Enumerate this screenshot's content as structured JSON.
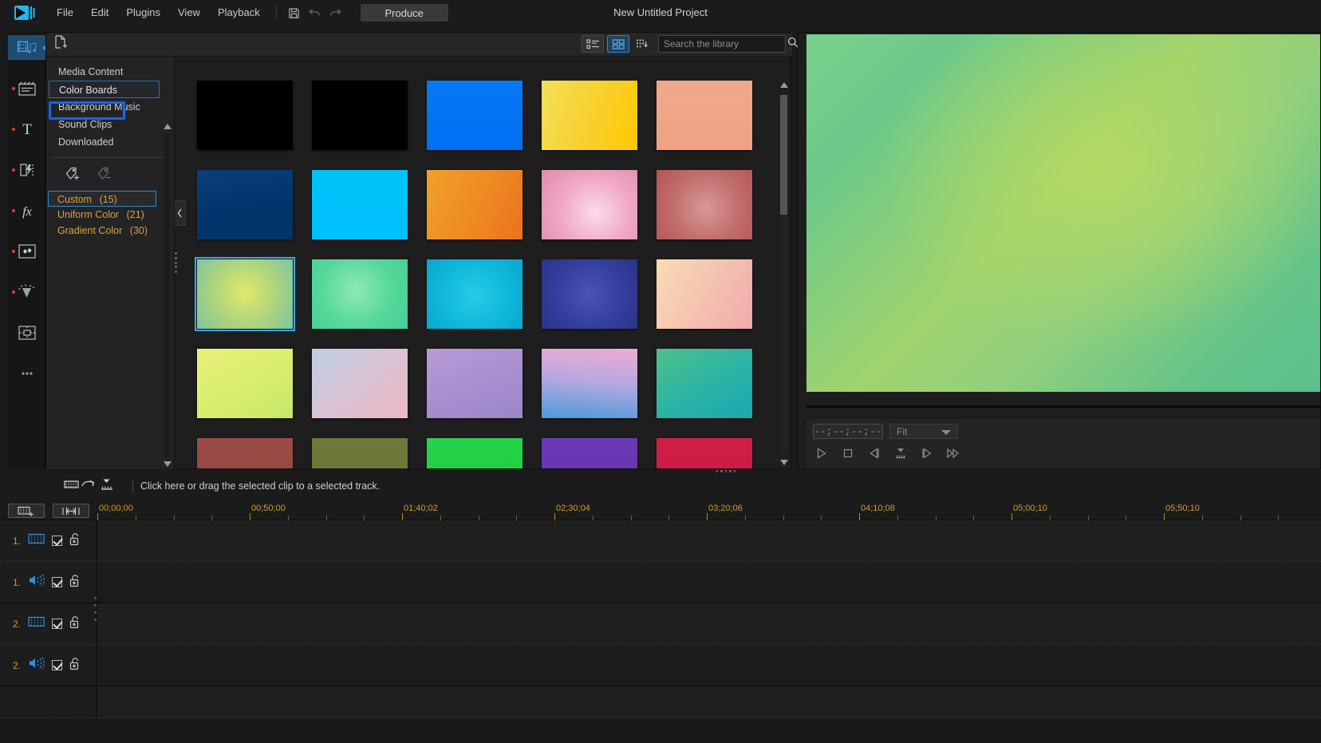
{
  "menu": {
    "logo_icon": "app-logo-icon",
    "items": [
      "File",
      "Edit",
      "Plugins",
      "View",
      "Playback"
    ],
    "save_icon": "save-icon",
    "undo_icon": "undo-icon",
    "redo_icon": "redo-icon",
    "produce_label": "Produce",
    "project_title": "New Untitled Project"
  },
  "rail": {
    "items": [
      {
        "name": "media-library",
        "icon": "media-music-icon",
        "active": true,
        "badge": false
      },
      {
        "name": "titles",
        "icon": "clapperboard-icon",
        "active": false,
        "badge": true
      },
      {
        "name": "text",
        "icon": "text-t-icon",
        "active": false,
        "badge": true
      },
      {
        "name": "transitions",
        "icon": "transition-icon",
        "active": false,
        "badge": true
      },
      {
        "name": "effects",
        "icon": "fx-icon",
        "active": false,
        "badge": true
      },
      {
        "name": "overlays",
        "icon": "overlay-star-icon",
        "active": false,
        "badge": true
      },
      {
        "name": "particles",
        "icon": "particle-icon",
        "active": false,
        "badge": true
      },
      {
        "name": "split-screen",
        "icon": "split-screen-icon",
        "active": false,
        "badge": false
      },
      {
        "name": "more",
        "icon": "more-dots-icon",
        "active": false,
        "badge": false
      }
    ]
  },
  "library": {
    "new_file_icon": "new-file-icon",
    "view_list_icon": "list-view-icon",
    "view_grid_icon": "grid-view-icon",
    "sort_icon": "sort-descending-icon",
    "selected_view": "grid",
    "search": {
      "placeholder": "Search the library",
      "value": "",
      "icon": "search-icon"
    },
    "categories": [
      {
        "label": "Media Content",
        "state": "normal"
      },
      {
        "label": "Color Boards",
        "state": "highlighted"
      },
      {
        "label": "Background Music",
        "state": "normal"
      },
      {
        "label": "Sound Clips",
        "state": "normal"
      },
      {
        "label": "Downloaded",
        "state": "normal"
      }
    ],
    "tag_tools": [
      {
        "name": "add-tag-icon",
        "label": ""
      },
      {
        "name": "remove-tag-icon",
        "label": ""
      }
    ],
    "tags": [
      {
        "label": "Custom",
        "count": "(15)",
        "selected": true
      },
      {
        "label": "Uniform Color",
        "count": "(21)",
        "selected": false
      },
      {
        "label": "Gradient Color",
        "count": "(30)",
        "selected": false
      }
    ],
    "collapse_icon": "chevron-left-icon",
    "scroll_up_icon": "triangle-up-icon",
    "scroll_down_icon": "triangle-down-icon",
    "swatches": [
      {
        "id": "sw-1",
        "css": "linear-gradient(180deg,#000 0%,#000 100%)",
        "selected": false
      },
      {
        "id": "sw-2",
        "css": "linear-gradient(180deg,#010101 0%,#000 100%)",
        "selected": false
      },
      {
        "id": "sw-3",
        "css": "linear-gradient(180deg,#0579f5 0%,#0070f2 100%)",
        "selected": false
      },
      {
        "id": "sw-4",
        "css": "linear-gradient(110deg,#f2e05a 0%,#f9cf2c 55%,#ffc800 100%)",
        "selected": false
      },
      {
        "id": "sw-5",
        "css": "linear-gradient(180deg,#f0a98c 0%,#efa183 100%)",
        "selected": false
      },
      {
        "id": "sw-6",
        "css": "linear-gradient(170deg,#0c3f77 0%,#02336c 55%,#013566 100%)",
        "selected": false
      },
      {
        "id": "sw-7",
        "css": "linear-gradient(180deg,#00c3fa 0%,#00c0fb 100%)",
        "selected": false
      },
      {
        "id": "sw-8",
        "css": "linear-gradient(115deg,#f0a02a 0%,#ee8a23 55%,#ec711f 100%)",
        "selected": false
      },
      {
        "id": "sw-9",
        "css": "radial-gradient(circle at 56% 62%, #fbdcea 0%, #f0a7c3 52%, #de8bae 100%)",
        "selected": false
      },
      {
        "id": "sw-10",
        "css": "radial-gradient(circle at 52% 55%, #d89a98 0%, #c37070 50%, #b45454 100%)",
        "selected": false
      },
      {
        "id": "sw-11",
        "css": "radial-gradient(circle at 50% 48%, #e3e86a 0%, #a8d27f 58%, #79c5a3 100%)",
        "selected": true
      },
      {
        "id": "sw-12",
        "css": "radial-gradient(circle at 46% 45%, #8fe9b4 0%, #56d89a 55%, #45cf97 100%)",
        "selected": false
      },
      {
        "id": "sw-13",
        "css": "radial-gradient(circle at 50% 52%, #27cbe6 0%, #0fb8da 55%, #0aa6cf 100%)",
        "selected": false
      },
      {
        "id": "sw-14",
        "css": "radial-gradient(circle at 50% 50%, #4a54b8 0%, #353f9e 55%, #2a3288 100%)",
        "selected": false
      },
      {
        "id": "sw-15",
        "css": "linear-gradient(120deg,#f8dcb4 0%,#f5c3b0 50%,#f0a9ad 100%)",
        "selected": false
      },
      {
        "id": "sw-16",
        "css": "linear-gradient(150deg,#e7f07a 0%,#dcee6d 45%,#c7e86b 100%)",
        "selected": false
      },
      {
        "id": "sw-17",
        "css": "linear-gradient(140deg,#bcd0e2 0%,#d6c3d6 45%,#edb9c4 100%)",
        "selected": false
      },
      {
        "id": "sw-18",
        "css": "linear-gradient(160deg,#b79bd8 0%,#a98fd0 50%,#9b86c9 100%)",
        "selected": false
      },
      {
        "id": "sw-19",
        "css": "linear-gradient(185deg,#eeabd2 0%,#b4a8e0 48%,#4e9ad8 100%)",
        "selected": false
      },
      {
        "id": "sw-20",
        "css": "linear-gradient(150deg,#4ec08a 0%,#2ab3a5 55%,#1aa8b4 100%)",
        "selected": false
      },
      {
        "id": "sw-21",
        "css": "linear-gradient(180deg,#9b4b44 0%,#8e4540 100%)",
        "selected": false
      },
      {
        "id": "sw-22",
        "css": "linear-gradient(180deg,#6d7a3b 0%,#687436 100%)",
        "selected": false
      },
      {
        "id": "sw-23",
        "css": "linear-gradient(180deg,#25d44a 0%,#1fcb45 100%)",
        "selected": false
      },
      {
        "id": "sw-24",
        "css": "linear-gradient(180deg,#6b39b5 0%,#6433ae 100%)",
        "selected": false
      },
      {
        "id": "sw-25",
        "css": "linear-gradient(180deg,#cf1f46 0%,#c61b41 100%)",
        "selected": false
      }
    ]
  },
  "preview": {
    "timecode": "--;--;--;--",
    "zoom_level": "Fit",
    "zoom_caret_icon": "caret-down-icon",
    "transport": [
      {
        "name": "play-button",
        "icon": "play-icon"
      },
      {
        "name": "stop-button",
        "icon": "stop-icon"
      },
      {
        "name": "previous-frame-button",
        "icon": "previous-frame-icon"
      },
      {
        "name": "mark-clip-button",
        "icon": "mark-clip-icon"
      },
      {
        "name": "next-frame-button",
        "icon": "next-frame-icon"
      },
      {
        "name": "fast-forward-button",
        "icon": "fast-forward-icon"
      }
    ]
  },
  "hint_bar": {
    "icons": [
      "insert-clip-icon",
      "arrow-curve-icon",
      "timeline-target-icon"
    ],
    "text": "Click here or drag the selected clip to a selected track."
  },
  "timeline": {
    "buttons": [
      {
        "name": "add-track-button",
        "icon": "add-track-icon"
      },
      {
        "name": "snap-button",
        "icon": "snap-magnet-icon"
      }
    ],
    "ruler_ticks": [
      "00;00;00",
      "00;50;00",
      "01;40;02",
      "02;30;04",
      "03;20;06",
      "04;10;08",
      "05;00;10",
      "05;50;10"
    ],
    "tracks": [
      {
        "num": "1.",
        "type": "video",
        "icon": "film-strip-icon",
        "enabled": true,
        "locked": false
      },
      {
        "num": "1.",
        "type": "audio",
        "icon": "speaker-icon",
        "enabled": true,
        "locked": false
      },
      {
        "num": "2.",
        "type": "video",
        "icon": "film-strip-icon",
        "enabled": true,
        "locked": false
      },
      {
        "num": "2.",
        "type": "audio",
        "icon": "speaker-icon",
        "enabled": true,
        "locked": false
      }
    ],
    "checkbox_icon": "checkbox-checked-icon",
    "lock_icon": "padlock-open-icon"
  },
  "colors": {
    "accent_blue": "#1464f0",
    "highlight_blue": "#2f86d6",
    "tag_gold": "#d4a24a",
    "ruler_gold": "#d39a2a",
    "badge_red": "#e03a2f",
    "panel_bg": "#1e1e1e",
    "window_bg": "#1b1b1b"
  }
}
